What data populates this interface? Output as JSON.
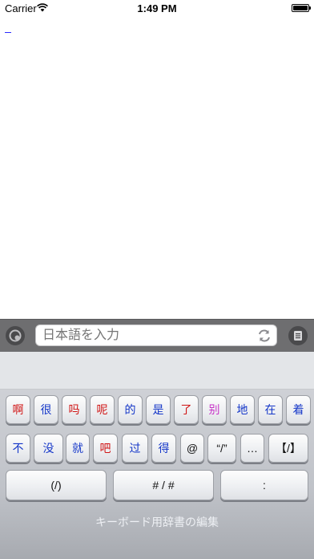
{
  "status_bar": {
    "carrier": "Carrier",
    "time": "1:49 PM"
  },
  "input_bar": {
    "placeholder": "日本語を入力"
  },
  "keyboard": {
    "row1": [
      {
        "label": "啊",
        "color": "red"
      },
      {
        "label": "很",
        "color": "blue"
      },
      {
        "label": "吗",
        "color": "red"
      },
      {
        "label": "呢",
        "color": "red"
      },
      {
        "label": "的",
        "color": "blue"
      },
      {
        "label": "是",
        "color": "blue"
      },
      {
        "label": "了",
        "color": "red"
      },
      {
        "label": "别",
        "color": "magenta"
      },
      {
        "label": "地",
        "color": "blue"
      },
      {
        "label": "在",
        "color": "blue"
      },
      {
        "label": "着",
        "color": "blue"
      }
    ],
    "row2": [
      {
        "label": "不",
        "color": "blue"
      },
      {
        "label": "没",
        "color": "blue"
      },
      {
        "label": "就",
        "color": "blue"
      },
      {
        "label": "吧",
        "color": "red"
      },
      {
        "label": "过",
        "color": "blue"
      },
      {
        "label": "得",
        "color": "blue"
      },
      {
        "label": "@",
        "color": "dark"
      },
      {
        "label": "“/”",
        "color": "dark"
      },
      {
        "label": "…",
        "color": "dark"
      },
      {
        "label": "【/】",
        "color": "dark"
      }
    ],
    "row3": [
      {
        "label": "(/)"
      },
      {
        "label": "# / #"
      },
      {
        "label": ":"
      }
    ],
    "dictionary_link": "キーボード用辞書の編集"
  },
  "colors": {
    "blue": "#1436c8",
    "red": "#d01414",
    "magenta": "#c832c8",
    "input_bar": "#6e6e70"
  }
}
